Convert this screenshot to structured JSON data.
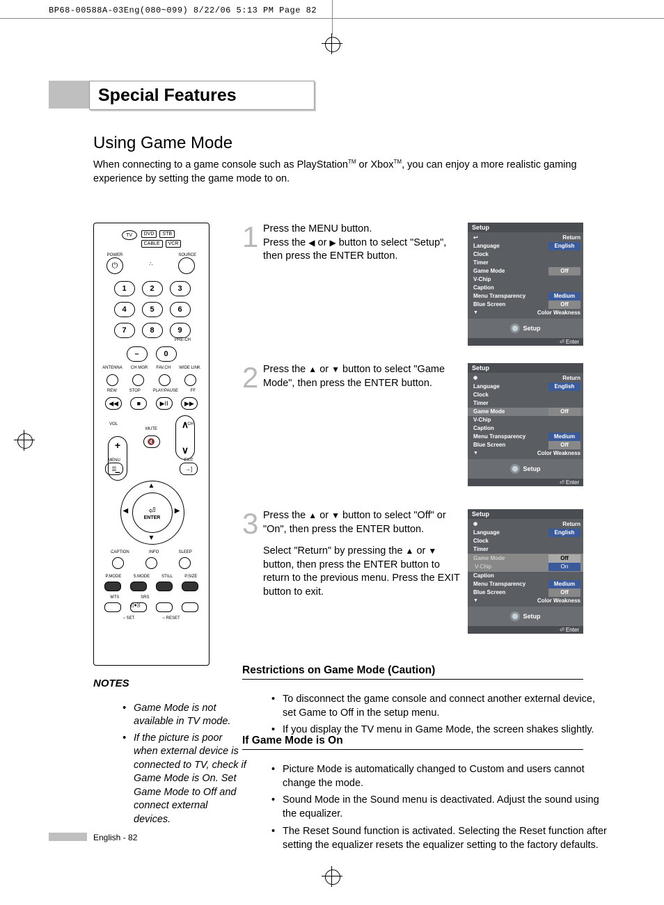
{
  "slug": "BP68-00588A-03Eng(080~099)  8/22/06  5:13 PM  Page 82",
  "section_tab": "Special Features",
  "h2": "Using Game Mode",
  "intro_a": "When connecting to a game console such as PlayStation",
  "intro_tm1": "TM",
  "intro_b": " or Xbox",
  "intro_tm2": "TM",
  "intro_c": ", you can enjoy a more realistic gaming experience by setting the game mode to on.",
  "steps": {
    "s1": {
      "num": "1",
      "text": "Press the MENU button.\nPress the ◀ or ▶ button to select \"Setup\", then press the ENTER button."
    },
    "s2": {
      "num": "2",
      "text": "Press the ▲ or ▼ button to select \"Game Mode\", then press the ENTER button."
    },
    "s3": {
      "num": "3",
      "text": "Press the ▲ or ▼ button to select \"Off\" or \"On\", then press the ENTER button.",
      "para2": "Select \"Return\" by pressing the ▲ or ▼ button, then press the ENTER button to return to the previous menu. Press the EXIT button to exit."
    }
  },
  "osd_common": {
    "title": "Setup",
    "return": "Return",
    "language": "Language",
    "language_val": "English",
    "clock": "Clock",
    "timer": "Timer",
    "game_mode": "Game Mode",
    "game_mode_val": "Off",
    "vchip": "V-Chip",
    "caption": "Caption",
    "transparency": "Menu Transparency",
    "transparency_val": "Medium",
    "blue": "Blue Screen",
    "blue_val": "Off",
    "color_weak": "Color Weakness",
    "foot": "Setup",
    "enter": "Enter",
    "opt_off": "Off",
    "opt_on": "On"
  },
  "restrictions_h": "Restrictions on Game Mode (Caution)",
  "restrictions": [
    "To disconnect the game console and connect another external device, set Game to Off in the setup menu.",
    "If you display the TV menu in Game Mode, the screen shakes slightly."
  ],
  "gameon_h": "If Game Mode is On",
  "gameon": [
    "Picture Mode is automatically changed to Custom and users cannot change the mode.",
    "Sound Mode in the Sound menu is deactivated. Adjust the sound using the equalizer.",
    "The Reset Sound function is activated. Selecting the Reset function after setting the equalizer resets the equalizer setting to the factory defaults."
  ],
  "notes_h": "NOTES",
  "notes": [
    "Game Mode is not available in TV mode.",
    "If the picture is poor when external device is connected to TV, check if Game Mode is On. Set Game Mode to Off and connect external devices."
  ],
  "footer": "English - 82",
  "remote": {
    "tv": "TV",
    "dvd": "DVD",
    "stb": "STB",
    "cable": "CABLE",
    "vcr": "VCR",
    "power": "POWER",
    "source": "SOURCE",
    "prech": "PRE-CH",
    "antenna": "ANTENNA",
    "chmgr": "CH MGR",
    "favch": "FAV.CH",
    "widelink": "WIDE LINK",
    "rew": "REW",
    "stop": "STOP",
    "play": "PLAY/PAUSE",
    "ff": "FF",
    "vol": "VOL",
    "ch": "CH",
    "mute": "MUTE",
    "menu": "MENU",
    "exit": "EXIT",
    "enter": "ENTER",
    "caption": "CAPTION",
    "info": "INFO",
    "sleep": "SLEEP",
    "pmode": "P.MODE",
    "smode": "S.MODE",
    "still": "STILL",
    "psize": "P.SIZE",
    "mts": "MTS",
    "srs": "SRS",
    "set": "SET",
    "reset": "RESET"
  }
}
